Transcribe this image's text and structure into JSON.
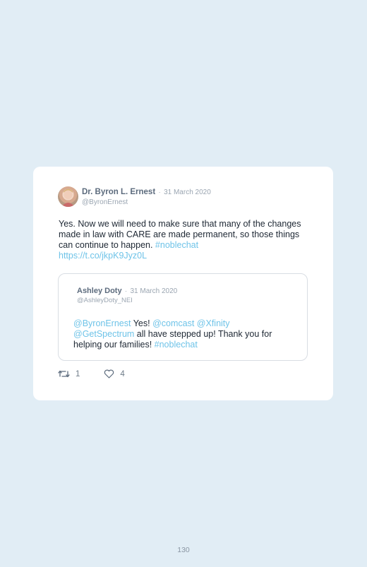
{
  "tweet": {
    "author_name": "Dr. Byron L. Ernest",
    "separator": "·",
    "date": "31 March 2020",
    "handle": "@ByronErnest",
    "text_main": "Yes. Now we will need to make sure that many of the changes made in law with CARE are made permanent, so those things can continue to happen. ",
    "hashtag": "#noblechat",
    "url": "https://t.co/jkpK9Jyz0L",
    "retweet_count": "1",
    "like_count": "4"
  },
  "quoted": {
    "author_name": "Ashley Doty",
    "separator": "·",
    "date": "31 March 2020",
    "handle": "@AshleyDoty_NEI",
    "mention1": "@ByronErnest",
    "text1": " Yes! ",
    "mention2": "@comcast",
    "mention3": "@Xfinity",
    "mention4": "@GetSpectrum",
    "text2": " all have stepped up! Thank you for helping our families! ",
    "hashtag": "#noblechat"
  },
  "page_number": "130",
  "colors": {
    "link": "#6ec3e8",
    "background": "#e1edf5"
  }
}
